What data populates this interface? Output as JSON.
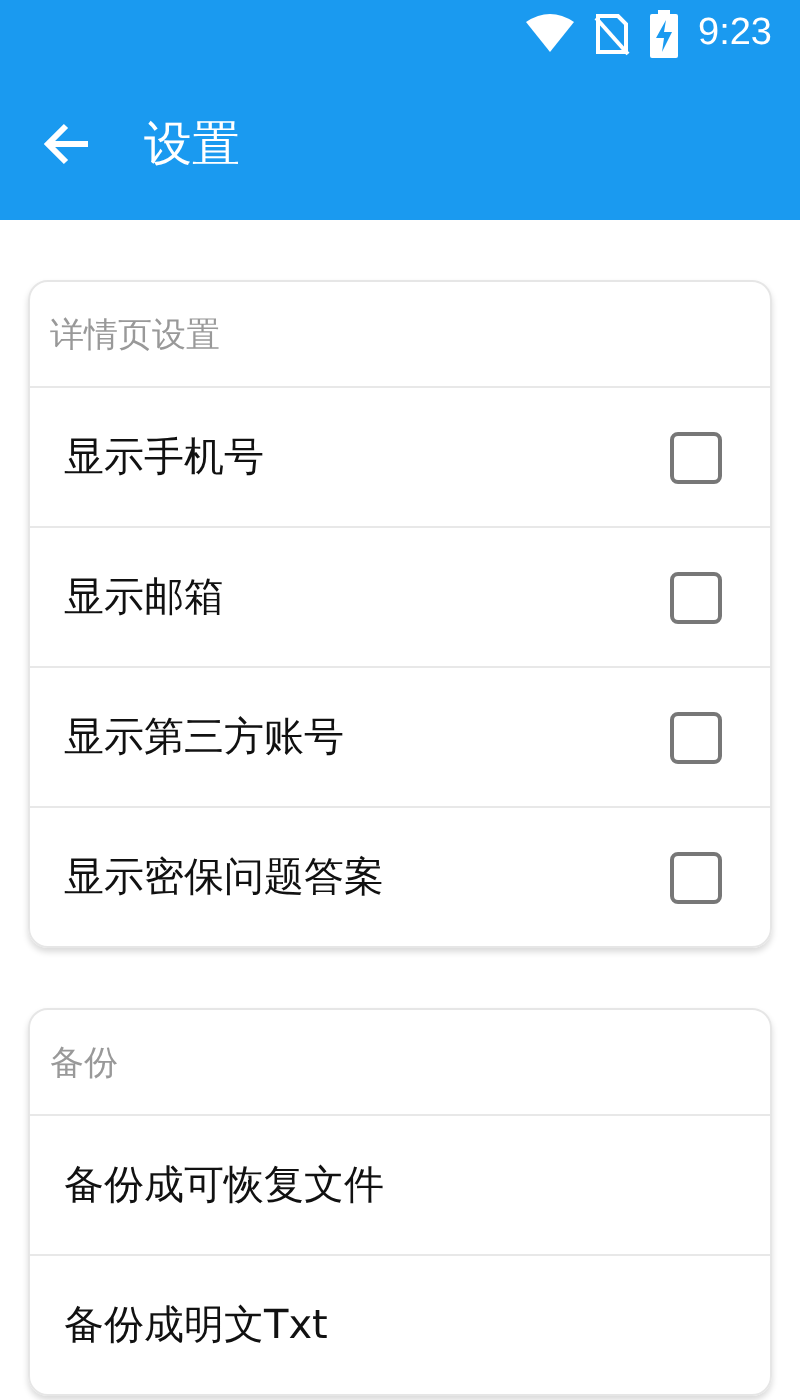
{
  "status_bar": {
    "time": "9:23"
  },
  "app_bar": {
    "title": "设置"
  },
  "sections": [
    {
      "title": "详情页设置",
      "items": [
        {
          "kind": "checkbox",
          "label": "显示手机号",
          "checked": false
        },
        {
          "kind": "checkbox",
          "label": "显示邮箱",
          "checked": false
        },
        {
          "kind": "checkbox",
          "label": "显示第三方账号",
          "checked": false
        },
        {
          "kind": "checkbox",
          "label": "显示密保问题答案",
          "checked": false
        }
      ]
    },
    {
      "title": "备份",
      "items": [
        {
          "kind": "action",
          "label": "备份成可恢复文件"
        },
        {
          "kind": "action",
          "label": "备份成明文Txt"
        }
      ]
    }
  ]
}
